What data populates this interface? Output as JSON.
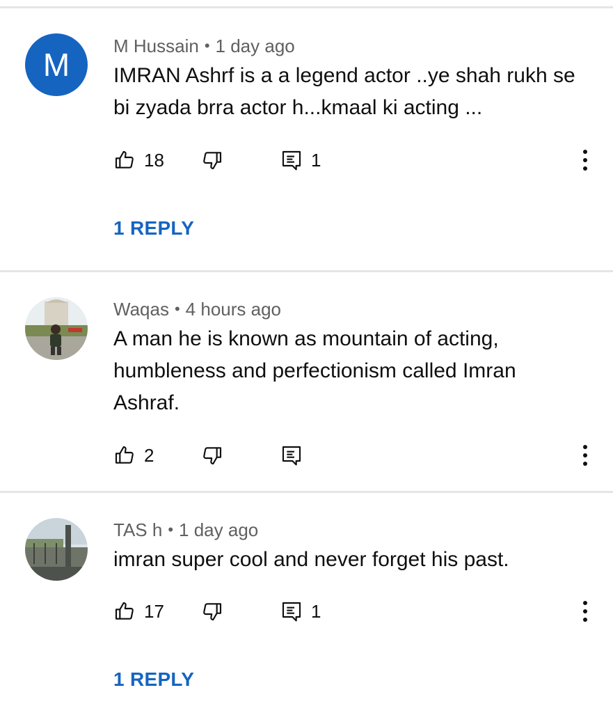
{
  "comments": [
    {
      "author": "M Hussain",
      "time": "1 day ago",
      "avatar_letter": "M",
      "text": "IMRAN Ashrf is a a legend actor ..ye shah rukh se bi zyada brra actor h...kmaal ki acting ...",
      "likes": "18",
      "replies_count": "1",
      "reply_link": "1 REPLY"
    },
    {
      "author": "Waqas",
      "time": "4 hours ago",
      "text": "A man he is known as mountain of acting, humbleness and perfectionism called Imran Ashraf.",
      "likes": "2",
      "replies_count": ""
    },
    {
      "author": "TAS h",
      "time": "1 day ago",
      "text": "imran super cool and never forget his past.",
      "likes": "17",
      "replies_count": "1",
      "reply_link": "1 REPLY"
    }
  ],
  "meta_separator": "•",
  "colors": {
    "accent": "#1565c0",
    "avatar_m": "#1565c0",
    "divider": "#e5e5e5",
    "secondary_text": "#606060"
  },
  "icons": [
    "thumbs-up-icon",
    "thumbs-down-icon",
    "reply-icon",
    "more-vert-icon"
  ]
}
